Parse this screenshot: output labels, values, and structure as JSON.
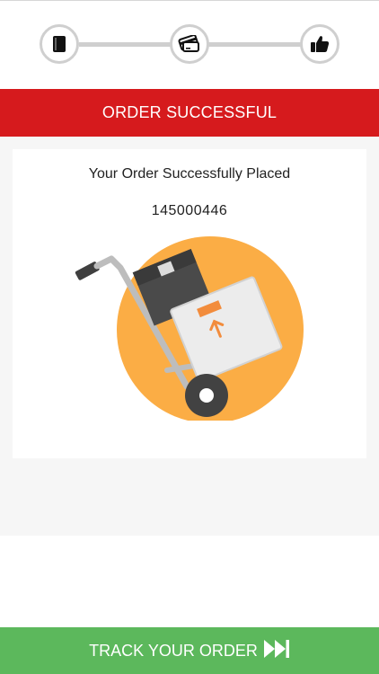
{
  "stepper": {
    "steps": [
      {
        "icon": "book-icon",
        "state": "complete"
      },
      {
        "icon": "credit-cards-icon",
        "state": "complete"
      },
      {
        "icon": "thumbs-up-icon",
        "state": "current"
      }
    ]
  },
  "banner": {
    "title": "ORDER SUCCESSFUL",
    "color": "#d61a1d"
  },
  "confirmation": {
    "message": "Your Order Successfully Placed",
    "order_number": "145000446",
    "illustration_icon": "hand-truck-with-boxes-icon"
  },
  "footer": {
    "track_label": "TRACK YOUR ORDER",
    "track_icon": "fast-forward-icon",
    "color": "#5cb85c"
  }
}
